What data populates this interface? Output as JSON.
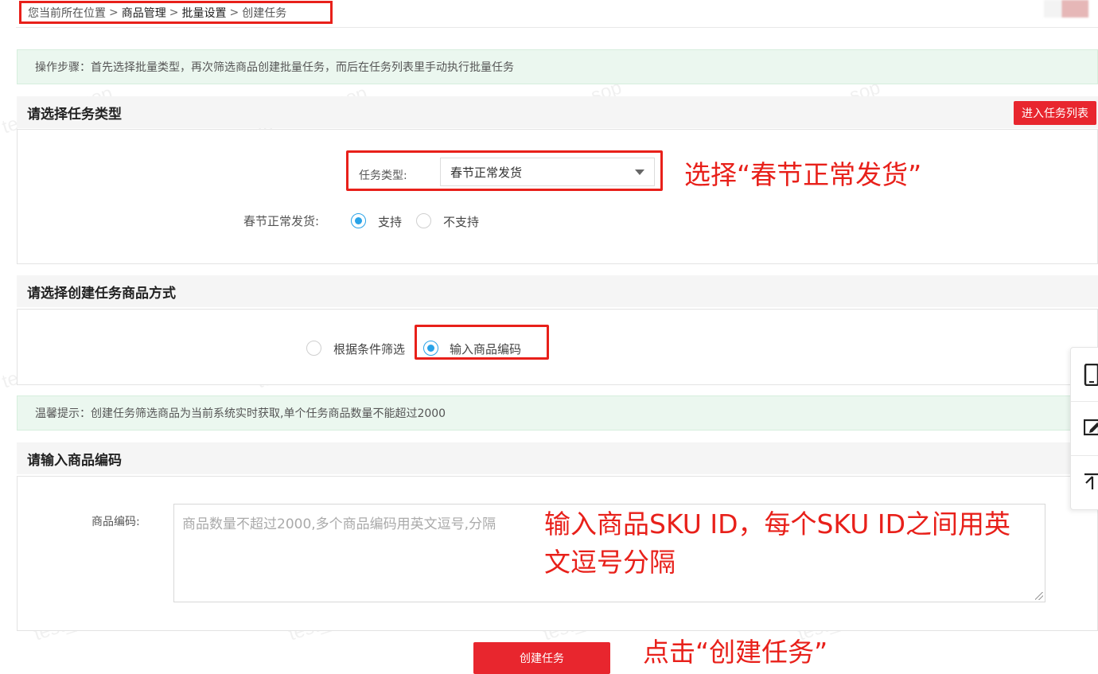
{
  "breadcrumb": {
    "prefix": "您当前所在位置",
    "separator": ">",
    "items": [
      "商品管理",
      "批量设置",
      "创建任务"
    ]
  },
  "tip_top": "操作步骤：首先选择批量类型，再次筛选商品创建批量任务，而后在任务列表里手动执行批量任务",
  "section_task_type": {
    "title": "请选择任务类型",
    "enter_list_button": "进入任务列表",
    "task_type_label": "任务类型:",
    "task_type_value": "春节正常发货",
    "support_label": "春节正常发货:",
    "options": [
      "支持",
      "不支持"
    ],
    "selected_option": "支持"
  },
  "section_method": {
    "title": "请选择创建任务商品方式",
    "options": [
      "根据条件筛选",
      "输入商品编码"
    ],
    "selected_option": "输入商品编码"
  },
  "tip_warm": "温馨提示：创建任务筛选商品为当前系统实时获取,单个任务商品数量不能超过2000",
  "section_input": {
    "title": "请输入商品编码",
    "code_label": "商品编码:",
    "placeholder": "商品数量不超过2000,多个商品编码用英文逗号,分隔"
  },
  "create_button": "创建任务",
  "annotations": {
    "select_hint": "选择“春节正常发货”",
    "input_hint_line1": "输入商品SKU ID，每个SKU ID之间用英",
    "input_hint_line2": "文逗号分隔",
    "click_hint": "点击“创建任务”"
  },
  "watermark": "test_pop_sop",
  "colors": {
    "accent_red": "#e8262e",
    "annotation_red": "#e8201a",
    "radio_blue": "#29a3e8",
    "tip_bg": "#ebf7ef"
  },
  "float_toolbar_icons": [
    "phone-icon",
    "edit-icon",
    "back-to-top-icon"
  ]
}
